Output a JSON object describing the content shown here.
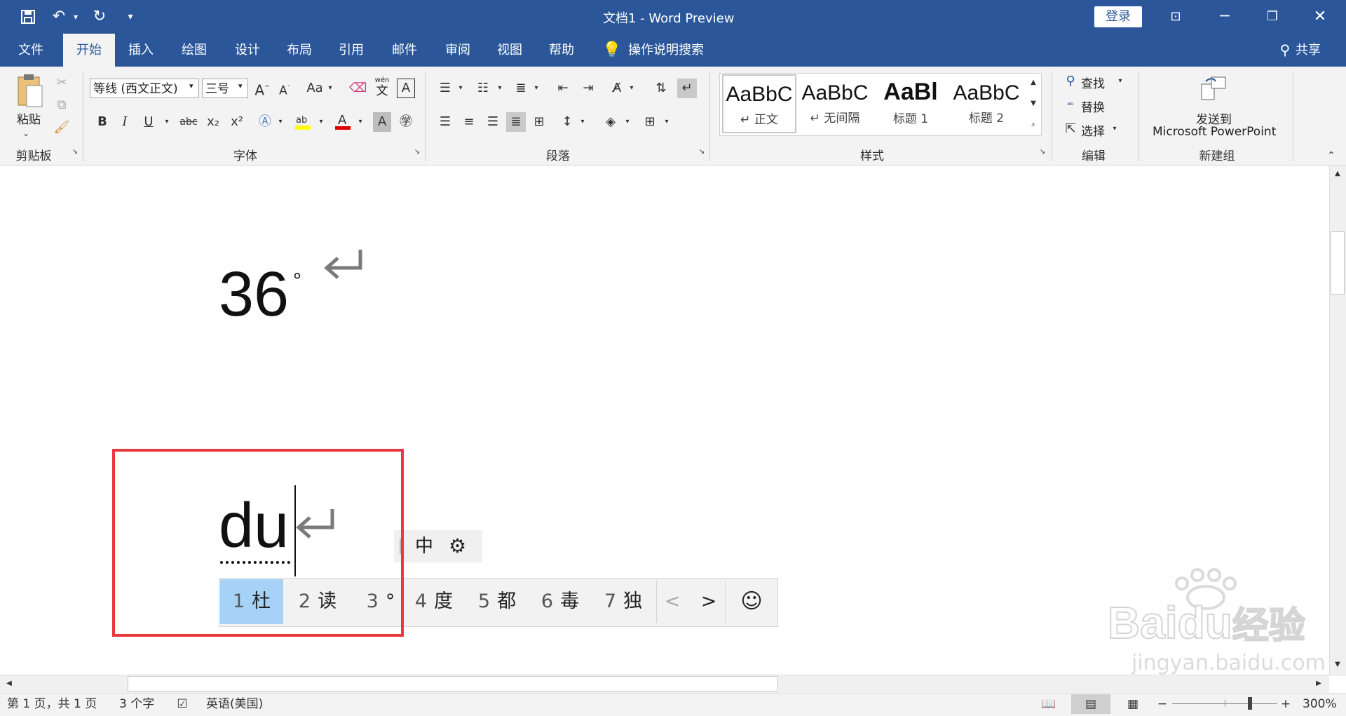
{
  "titlebar": {
    "title": "文档1  -  Word Preview",
    "login": "登录",
    "bg": "#2b579a"
  },
  "tabs": [
    "文件",
    "开始",
    "插入",
    "绘图",
    "设计",
    "布局",
    "引用",
    "邮件",
    "审阅",
    "视图",
    "帮助"
  ],
  "tell_me": "操作说明搜索",
  "share": "共享",
  "ribbon": {
    "clipboard": {
      "paste": "粘贴",
      "group": "剪贴板"
    },
    "font": {
      "name": "等线 (西文正文)",
      "size": "三号",
      "group": "字体",
      "aa": "Aa",
      "wen_top": "wén",
      "wen": "文",
      "a_box": "A",
      "bold": "B",
      "italic": "I",
      "underline": "U",
      "strike": "abc",
      "sub": "x₂",
      "sup": "x²"
    },
    "paragraph": {
      "group": "段落"
    },
    "styles": {
      "group": "样式",
      "sample": "AaBbC",
      "heading_sample": "AaBl",
      "items": [
        "↵ 正文",
        "↵ 无间隔",
        "标题 1",
        "标题 2"
      ]
    },
    "editing": {
      "find": "查找",
      "replace": "替换",
      "select": "选择",
      "group": "编辑"
    },
    "newgroup": {
      "send_to": "发送到",
      "app": "Microsoft PowerPoint",
      "group": "新建组"
    }
  },
  "document": {
    "line1": "36",
    "degree": "°",
    "typing": "du"
  },
  "ime": {
    "mode": "中",
    "candidates": [
      {
        "n": "1",
        "c": "杜"
      },
      {
        "n": "2",
        "c": "读"
      },
      {
        "n": "3",
        "c": "°"
      },
      {
        "n": "4",
        "c": "度"
      },
      {
        "n": "5",
        "c": "都"
      },
      {
        "n": "6",
        "c": "毒"
      },
      {
        "n": "7",
        "c": "独"
      }
    ],
    "selected_index": 0,
    "prev": "<",
    "next": ">"
  },
  "statusbar": {
    "page": "第 1 页，共 1 页",
    "words": "3 个字",
    "lang": "英语(美国)",
    "zoom": "300%"
  },
  "watermark": {
    "brand": "Bai",
    "brand2": "du",
    "brand_cn": "经验",
    "url": "jingyan.baidu.com"
  },
  "highlight_color": "#e8383d"
}
